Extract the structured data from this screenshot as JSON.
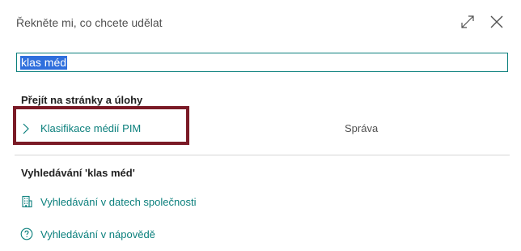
{
  "dialog": {
    "title": "Řekněte mi, co chcete udělat",
    "expand_icon": "expand-icon",
    "close_icon": "close-icon"
  },
  "search": {
    "value": "klas méd"
  },
  "goto_section": {
    "header": "Přejít na stránky a úlohy",
    "results": [
      {
        "label": "Klasifikace médií PIM",
        "category": "Správa",
        "icon": "chevron-right-icon"
      }
    ]
  },
  "search_section": {
    "header": "Vyhledávání 'klas méd'",
    "links": [
      {
        "label": "Vyhledávání v datech společnosti",
        "icon": "building-icon"
      },
      {
        "label": "Vyhledávání v nápovědě",
        "icon": "help-circle-icon"
      }
    ]
  },
  "colors": {
    "accent": "#0a7f7c",
    "highlight_border": "#7a1a26",
    "selection": "#2f6fdd"
  }
}
